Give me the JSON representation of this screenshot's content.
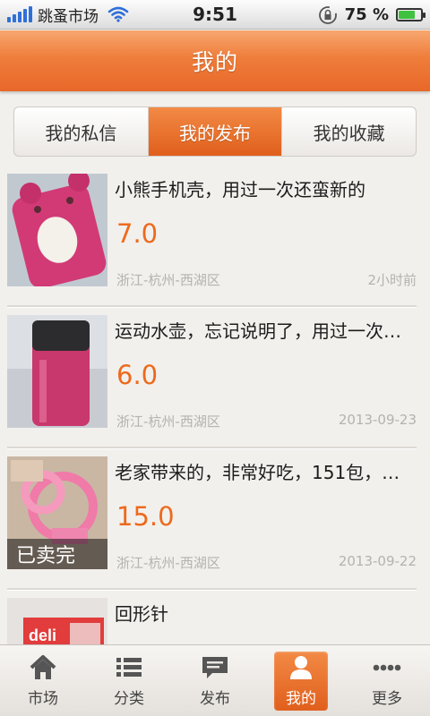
{
  "status_bar": {
    "carrier": "跳蚤市场",
    "time": "9:51",
    "battery_percent": "75 %",
    "battery_level": 0.75,
    "signal_bars": 5
  },
  "header": {
    "title": "我的"
  },
  "segments": [
    {
      "label": "我的私信",
      "active": false
    },
    {
      "label": "我的发布",
      "active": true
    },
    {
      "label": "我的收藏",
      "active": false
    }
  ],
  "items": [
    {
      "title": "小熊手机壳，用过一次还蛮新的",
      "price": "7.0",
      "location": "浙江-杭州-西湖区",
      "time": "2小时前",
      "sold_label": ""
    },
    {
      "title": "运动水壶，忘记说明了，用过一次…",
      "price": "6.0",
      "location": "浙江-杭州-西湖区",
      "time": "2013-09-23",
      "sold_label": ""
    },
    {
      "title": "老家带来的，非常好吃，151包，…",
      "price": "15.0",
      "location": "浙江-杭州-西湖区",
      "time": "2013-09-22",
      "sold_label": "已卖完"
    },
    {
      "title": "回形针",
      "price": "",
      "location": "",
      "time": "",
      "sold_label": ""
    }
  ],
  "tabbar": {
    "market": "市场",
    "category": "分类",
    "publish": "发布",
    "mine": "我的",
    "more": "更多"
  },
  "colors": {
    "accent": "#e8682a",
    "price": "#ed6a1c"
  }
}
